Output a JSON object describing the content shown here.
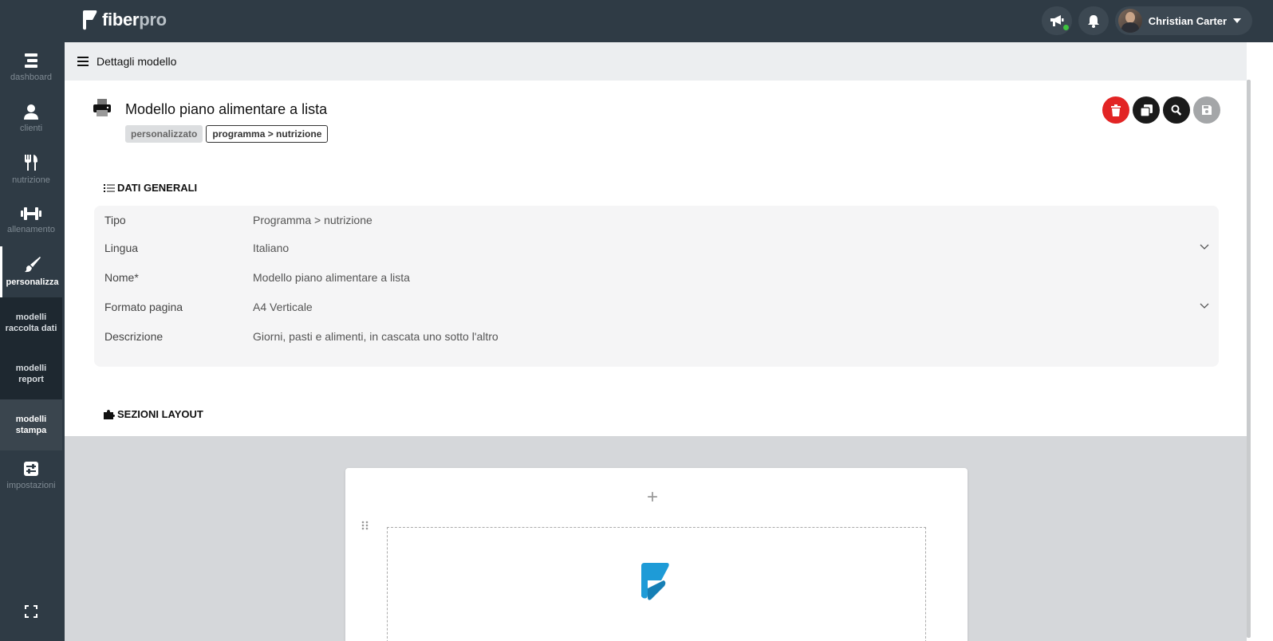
{
  "brand": {
    "name_main": "fiber",
    "name_suffix": "pro",
    "color": "#1e9bd7"
  },
  "topbar": {
    "announcements_icon": "megaphone-icon",
    "notifications_icon": "bell-icon",
    "user_name": "Christian Carter"
  },
  "sidebar": {
    "items": [
      {
        "label": "dashboard",
        "icon": "dashboard-icon"
      },
      {
        "label": "clienti",
        "icon": "user-icon"
      },
      {
        "label": "nutrizione",
        "icon": "fork-knife-icon"
      },
      {
        "label": "allenamento",
        "icon": "dumbbell-icon"
      },
      {
        "label": "personalizza",
        "icon": "paintbrush-icon"
      },
      {
        "label": "impostazioni",
        "icon": "sliders-icon"
      }
    ],
    "subitems": [
      {
        "label": "modelli raccolta dati"
      },
      {
        "label": "modelli report"
      },
      {
        "label": "modelli stampa"
      }
    ],
    "fullscreen_icon": "expand-icon"
  },
  "header": {
    "title": "Dettagli modello"
  },
  "model": {
    "title": "Modello piano alimentare a lista",
    "badge_custom": "personalizzato",
    "badge_type": "programma > nutrizione"
  },
  "sections": {
    "general": "DATI GENERALI",
    "layout": "SEZIONI LAYOUT"
  },
  "fields": [
    {
      "label": "Tipo",
      "value": "Programma > nutrizione",
      "dropdown": false
    },
    {
      "label": "Lingua",
      "value": "Italiano",
      "dropdown": true
    },
    {
      "label": "Nome*",
      "value": "Modello piano alimentare a lista",
      "dropdown": false
    },
    {
      "label": "Formato pagina",
      "value": "A4 Verticale",
      "dropdown": true
    },
    {
      "label": "Descrizione",
      "value": "Giorni, pasti e alimenti, in cascata uno sotto l'altro",
      "dropdown": false
    }
  ],
  "layout": {
    "add_symbol": "+"
  },
  "colors": {
    "delete": "#e22424",
    "action_dark": "#1a1a1a",
    "action_disabled": "#a4a6a8",
    "topbar": "#2f3b45"
  }
}
